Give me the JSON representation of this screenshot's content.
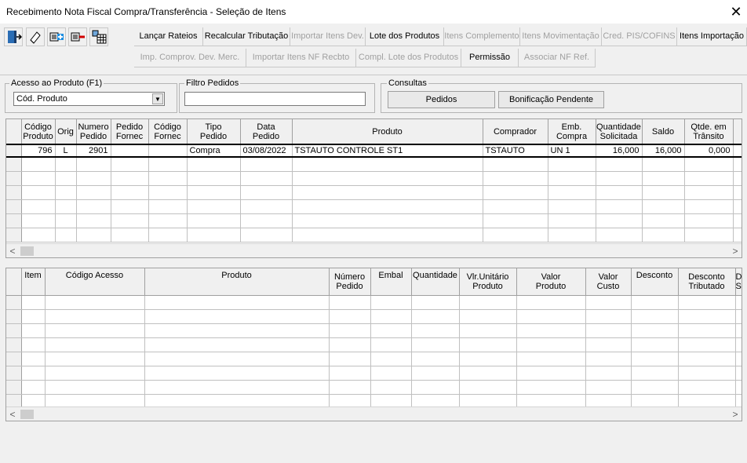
{
  "window": {
    "title": "Recebimento Nota Fiscal Compra/Transferência - Seleção de Itens",
    "close": "✕"
  },
  "toolbar_row1": [
    {
      "label": "Lançar Rateios",
      "enabled": true
    },
    {
      "label": "Recalcular Tributação",
      "enabled": true
    },
    {
      "label": "Importar Itens Dev.",
      "enabled": false
    },
    {
      "label": "Lote dos Produtos",
      "enabled": true
    },
    {
      "label": "Itens Complemento",
      "enabled": false
    },
    {
      "label": "Itens Movimentação",
      "enabled": false
    },
    {
      "label": "Cred. PIS/COFINS",
      "enabled": false
    },
    {
      "label": "Itens Importação",
      "enabled": true
    }
  ],
  "toolbar_row2": [
    {
      "label": "Imp. Comprov. Dev. Merc.",
      "enabled": false
    },
    {
      "label": "Importar Itens NF Recbto",
      "enabled": false
    },
    {
      "label": "Compl. Lote dos Produtos",
      "enabled": false
    },
    {
      "label": "Permissão",
      "enabled": true
    },
    {
      "label": "Associar NF Ref.",
      "enabled": false
    }
  ],
  "acesso": {
    "label": "Acesso ao Produto (F1)",
    "value": "Cód. Produto"
  },
  "filtro": {
    "label": "Filtro Pedidos",
    "value": ""
  },
  "consultas": {
    "label": "Consultas",
    "pedidos": "Pedidos",
    "bonificacao": "Bonificação Pendente"
  },
  "grid1": {
    "headers": [
      "Código\nProduto",
      "Orig",
      "Numero\nPedido",
      "Pedido\nFornec",
      "Código\nFornec",
      "Tipo\nPedido",
      "Data\nPedido",
      "Produto",
      "Comprador",
      "Emb.\nCompra",
      "Quantidade\nSolicitada",
      "Saldo",
      "Qtde. em\nTrânsito"
    ],
    "rows": [
      [
        "796",
        "L",
        "2901",
        "",
        "",
        "Compra",
        "03/08/2022",
        "TSTAUTO CONTROLE ST1",
        "TSTAUTO",
        "UN  1",
        "16,000",
        "16,000",
        "0,000"
      ]
    ]
  },
  "grid2": {
    "headers": [
      "Item",
      "Código Acesso",
      "Produto",
      "Número\nPedido",
      "Embal",
      "Quantidade",
      "Vlr.Unitário\nProduto",
      "Valor\nProduto",
      "Valor\nCusto",
      "Desconto",
      "Desconto\nTributado",
      "D\nS"
    ]
  }
}
